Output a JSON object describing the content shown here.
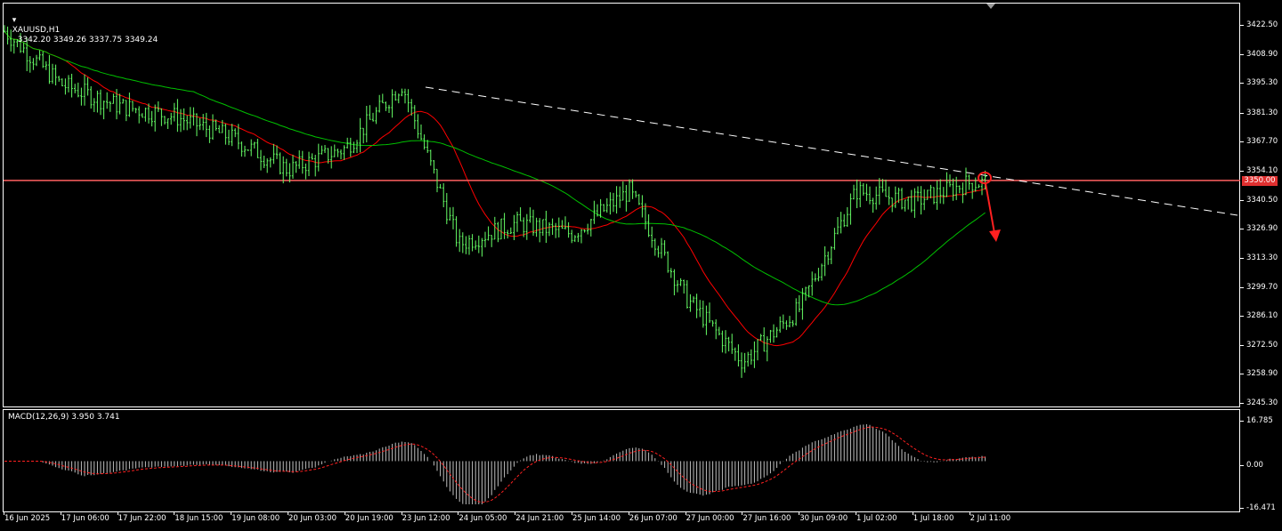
{
  "symbol_header": "XAUUSD,H1",
  "ohlc_header": "3342.20 3349.26 3337.75 3349.24",
  "macd_header": "MACD(12,26,9) 3.950 3.741",
  "price_axis": [
    "3422.50",
    "3408.90",
    "3395.30",
    "3381.30",
    "3367.70",
    "3354.10",
    "3340.50",
    "3326.90",
    "3313.30",
    "3299.70",
    "3286.10",
    "3272.50",
    "3258.90",
    "3245.30"
  ],
  "price_axis_values": [
    3422.5,
    3408.9,
    3395.3,
    3381.3,
    3367.7,
    3354.1,
    3340.5,
    3326.9,
    3313.3,
    3299.7,
    3286.1,
    3272.5,
    3258.9,
    3245.3
  ],
  "hline_label": "3350.00",
  "macd_axis": [
    "16.785",
    "0.00",
    "-16.471"
  ],
  "time_axis": [
    "16 Jun 2025",
    "17 Jun 06:00",
    "17 Jun 22:00",
    "18 Jun 15:00",
    "19 Jun 08:00",
    "20 Jun 03:00",
    "20 Jun 19:00",
    "23 Jun 12:00",
    "24 Jun 05:00",
    "24 Jun 21:00",
    "25 Jun 14:00",
    "26 Jun 07:00",
    "27 Jun 00:00",
    "27 Jun 16:00",
    "30 Jun 09:00",
    "1 Jul 02:00",
    "1 Jul 18:00",
    "2 Jul 11:00"
  ],
  "colors": {
    "background": "#000000",
    "candle": "#66ff66",
    "ma_fast": "#ff0000",
    "ma_slow": "#00c000",
    "trendline": "#ffffff",
    "hline": "#ff6060",
    "macd_hist": "#c0c0c0",
    "macd_signal": "#ff2020",
    "annotation": "#ff2020"
  },
  "chart_data": {
    "type": "candlestick",
    "symbol": "XAUUSD",
    "timeframe": "H1",
    "ylim": [
      3245.3,
      3422.5
    ],
    "horizontal_level": 3350.0,
    "price_path_points": [
      [
        "16 Jun 2025",
        3420
      ],
      [
        "17 Jun 06:00",
        3395
      ],
      [
        "17 Jun 22:00",
        3385
      ],
      [
        "18 Jun 15:00",
        3380
      ],
      [
        "19 Jun 08:00",
        3370
      ],
      [
        "20 Jun 03:00",
        3355
      ],
      [
        "20 Jun 19:00",
        3365
      ],
      [
        "23 Jun 12:00",
        3395
      ],
      [
        "24 Jun 05:00",
        3320
      ],
      [
        "24 Jun 21:00",
        3330
      ],
      [
        "25 Jun 14:00",
        3325
      ],
      [
        "26 Jun 07:00",
        3345
      ],
      [
        "27 Jun 00:00",
        3295
      ],
      [
        "27 Jun 16:00",
        3265
      ],
      [
        "30 Jun 09:00",
        3290
      ],
      [
        "1 Jul 02:00",
        3345
      ],
      [
        "1 Jul 18:00",
        3340
      ],
      [
        "2 Jul 11:00",
        3349
      ]
    ],
    "macd": {
      "value": 3.95,
      "signal": 3.741,
      "ylim": [
        -16.471,
        16.785
      ]
    }
  }
}
